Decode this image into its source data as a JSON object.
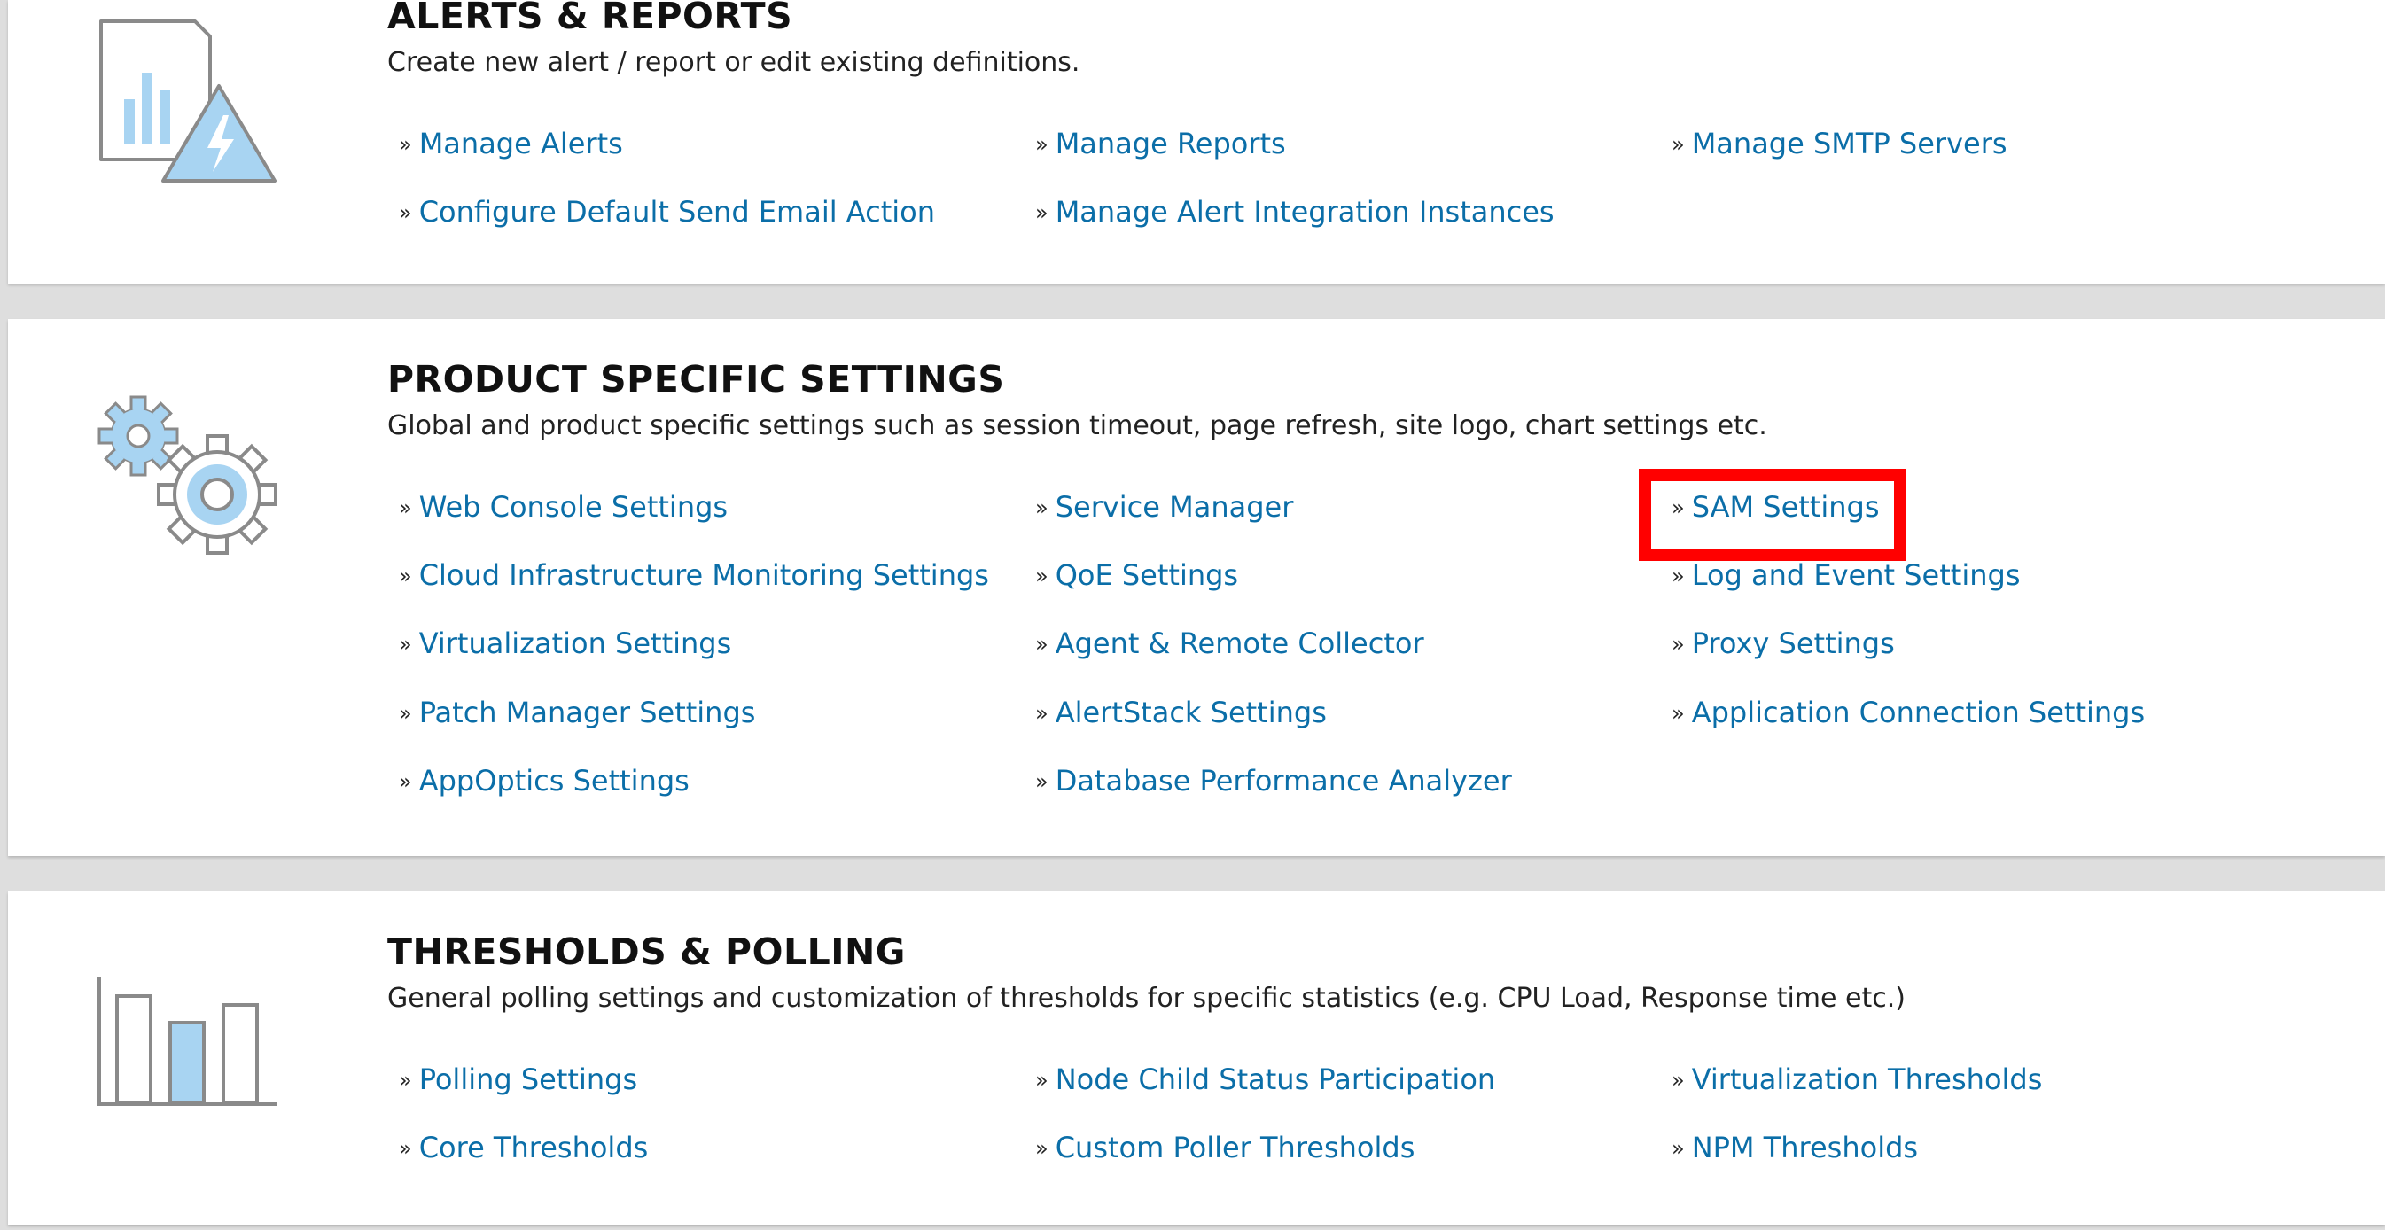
{
  "sections": {
    "alerts": {
      "title": "ALERTS & REPORTS",
      "description": "Create new alert / report or edit existing definitions.",
      "icon": "alert-report-icon",
      "links": [
        "Manage Alerts",
        "Manage Reports",
        "Manage SMTP Servers",
        "Configure Default Send Email Action",
        "Manage Alert Integration Instances"
      ]
    },
    "product": {
      "title": "PRODUCT SPECIFIC SETTINGS",
      "description": "Global and product specific settings such as session timeout, page refresh, site logo, chart settings etc.",
      "icon": "gears-icon",
      "links": [
        "Web Console Settings",
        "Service Manager",
        "SAM Settings",
        "Cloud Infrastructure Monitoring Settings",
        "QoE Settings",
        "Log and Event Settings",
        "Virtualization Settings",
        "Agent & Remote Collector",
        "Proxy Settings",
        "Patch Manager Settings",
        "AlertStack Settings",
        "Application Connection Settings",
        "AppOptics Settings",
        "Database Performance Analyzer"
      ]
    },
    "thresholds": {
      "title": "THRESHOLDS & POLLING",
      "description": "General polling settings and customization of thresholds for specific statistics (e.g. CPU Load, Response time etc.)",
      "icon": "bar-chart-icon",
      "links": [
        "Polling Settings",
        "Node Child Status Participation",
        "Virtualization Thresholds",
        "Core Thresholds",
        "Custom Poller Thresholds",
        "NPM Thresholds"
      ]
    }
  },
  "link_marker": "»",
  "colors": {
    "link": "#0b6ea8",
    "highlight": "#ff0000",
    "icon_fill": "#a8d4f2",
    "icon_stroke": "#8a8a8a"
  }
}
